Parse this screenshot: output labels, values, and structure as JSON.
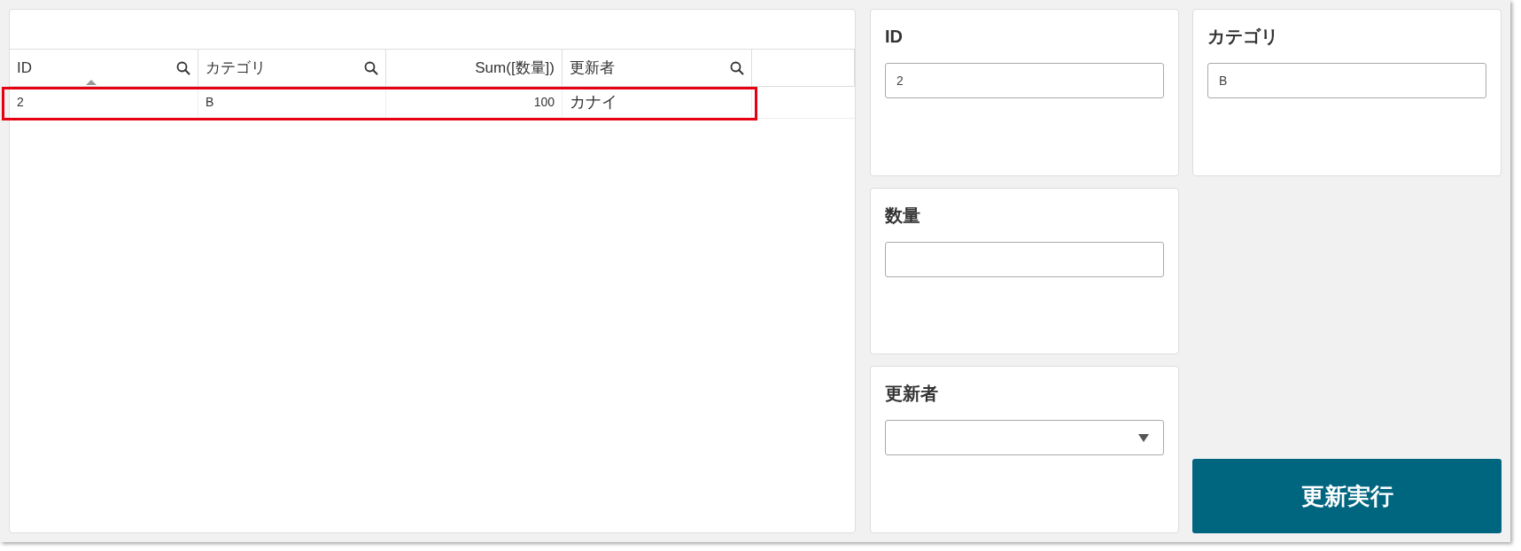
{
  "table": {
    "columns": [
      {
        "label": "ID",
        "kind": "text",
        "searchable": true,
        "sorted": true
      },
      {
        "label": "カテゴリ",
        "kind": "text",
        "searchable": true,
        "sorted": false
      },
      {
        "label": "Sum([数量])",
        "kind": "measure",
        "searchable": false,
        "sorted": false
      },
      {
        "label": "更新者",
        "kind": "text",
        "searchable": true,
        "sorted": false
      }
    ],
    "rows": [
      {
        "cells": [
          "2",
          "B",
          "100",
          "カナイ"
        ],
        "highlighted": true
      }
    ]
  },
  "fields": [
    {
      "label": "ID",
      "kind": "text",
      "value": "2"
    },
    {
      "label": "カテゴリ",
      "kind": "text",
      "value": "B"
    },
    {
      "label": "数量",
      "kind": "text"
    },
    {
      "label": "更新者",
      "kind": "dropdown"
    }
  ],
  "button": {
    "label": "更新実行"
  }
}
